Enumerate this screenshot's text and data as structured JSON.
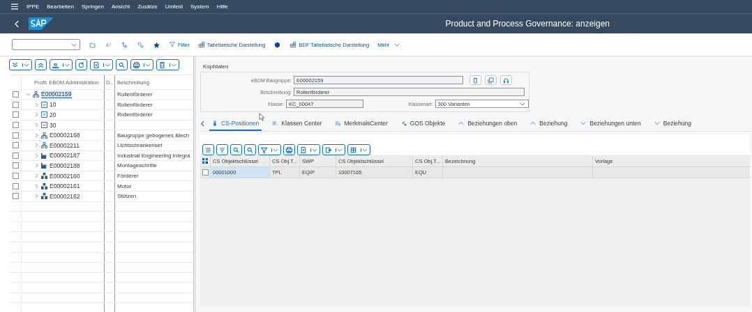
{
  "menu": [
    "IPPE",
    "Bearbeiten",
    "Springen",
    "Ansicht",
    "Zusätze",
    "Umfeld",
    "System",
    "Hilfe"
  ],
  "title": "Product and Process Governance: anzeigen",
  "toolbar": {
    "actions": [
      {
        "label": "Filter",
        "kind": "filter"
      },
      {
        "label": "Tabellarische Darstellung",
        "kind": "table"
      },
      {
        "label": "BDF Tabellarische Darstellung",
        "kind": "table"
      }
    ],
    "more": "Mehr"
  },
  "tree": {
    "columns": [
      "Profil: EBOM Administration",
      "D..",
      "Beschreibung"
    ],
    "nodes": [
      {
        "kind": "assembly",
        "id": "E00002159",
        "description": "Rollenförderer",
        "expanded": true,
        "focused": true,
        "checked": false,
        "children": [
          {
            "kind": "item",
            "id": "10",
            "description": "Rollenförderer",
            "expanded": false,
            "focused": false,
            "checked": false
          },
          {
            "kind": "item",
            "id": "20",
            "description": "Rollenförderer",
            "expanded": false,
            "focused": false,
            "checked": false
          },
          {
            "kind": "item",
            "id": "30",
            "expanded": false,
            "focused": false,
            "checked": false
          },
          {
            "kind": "assembly",
            "id": "E00002168",
            "description": "Baugruppe gebogenes Blech",
            "expanded": false,
            "focused": false,
            "checked": false
          },
          {
            "kind": "assembly",
            "id": "E00002211",
            "description": "Lichtschrankenset",
            "expanded": false,
            "focused": false,
            "checked": false
          },
          {
            "kind": "factory",
            "id": "E00002187",
            "description": "Industrial Engineering Integra",
            "expanded": false,
            "focused": false,
            "checked": false
          },
          {
            "kind": "factory",
            "id": "E00002188",
            "description": "Montageschritte",
            "expanded": false,
            "focused": false,
            "checked": false
          },
          {
            "kind": "material",
            "id": "E00002160",
            "description": "Förderer",
            "expanded": false,
            "focused": false,
            "checked": false
          },
          {
            "kind": "material",
            "id": "E00002161",
            "description": "Motor",
            "expanded": false,
            "focused": false,
            "checked": false
          },
          {
            "kind": "material",
            "id": "E00002162",
            "description": "Stützen",
            "expanded": false,
            "focused": false,
            "checked": false
          }
        ]
      }
    ]
  },
  "header": {
    "title": "Kopfdaten",
    "assembly_label": "eBOM Baugruppe:",
    "assembly": "E00002159",
    "description_label": "Beschreibung:",
    "description": "Rollenförderer",
    "class_label": "Klasse:",
    "class": "KC_00047",
    "class_type_label": "Klassenart:",
    "class_type": "300 Varianten"
  },
  "tabs": [
    {
      "label": "CS-Positionen",
      "kind": "positions",
      "selected": true
    },
    {
      "label": "Klassen Center",
      "kind": "class",
      "selected": false
    },
    {
      "label": "MerkmalsCenter",
      "kind": "feature",
      "selected": false
    },
    {
      "label": "GOS Objekte",
      "kind": "gos",
      "selected": false
    },
    {
      "label": "Beziehungen oben",
      "kind": "up",
      "selected": false
    },
    {
      "label": "Beziehung",
      "kind": "up",
      "selected": false
    },
    {
      "label": "Beziehungen unten",
      "kind": "down",
      "selected": false
    },
    {
      "label": "Beziehung",
      "kind": "down",
      "selected": false
    }
  ],
  "table": {
    "columns": [
      "CS Objektschlüssel",
      "CS Obj.T...",
      "SWP",
      "CS Objektschlüssel",
      "CS Obj.T...",
      "Bezeichnung",
      "Vorlage"
    ],
    "rows": [
      {
        "checked": false,
        "cells": [
          {
            "text": "00001000",
            "focused": true
          },
          {
            "text": "TPL",
            "focused": false
          },
          {
            "text": "EQIP",
            "focused": false
          },
          {
            "text": "10007165",
            "focused": false
          },
          {
            "text": "EQU",
            "focused": false
          },
          {
            "text": "",
            "focused": false
          },
          {
            "text": "",
            "focused": false
          }
        ]
      }
    ]
  }
}
